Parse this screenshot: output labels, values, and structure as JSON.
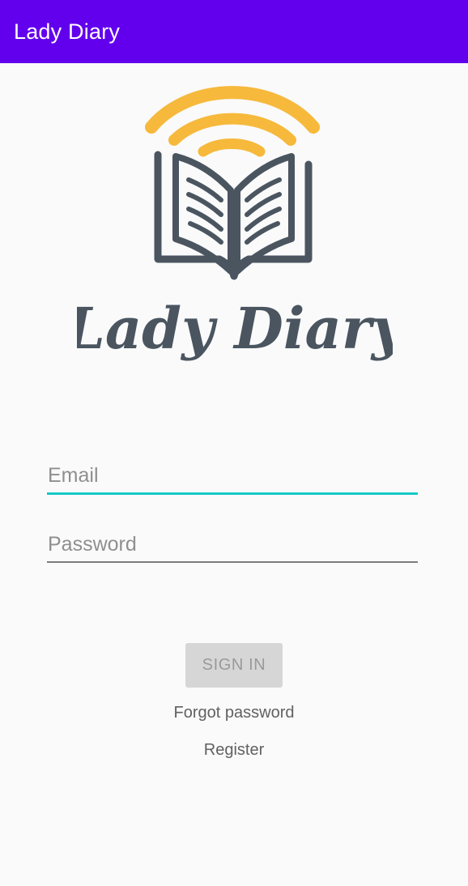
{
  "app_bar": {
    "title": "Lady Diary",
    "background_color": "#6200ee"
  },
  "logo": {
    "icon": "book-with-signal-waves-icon",
    "wordmark": "Lady Diary",
    "wave_color": "#f6b93b",
    "book_color": "#4a5560"
  },
  "form": {
    "email_placeholder": "Email",
    "email_value": "",
    "email_focused_color": "#14c9c7",
    "password_placeholder": "Password",
    "password_value": "",
    "sign_in_label": "SIGN IN",
    "forgot_password_label": "Forgot password",
    "register_label": "Register"
  }
}
